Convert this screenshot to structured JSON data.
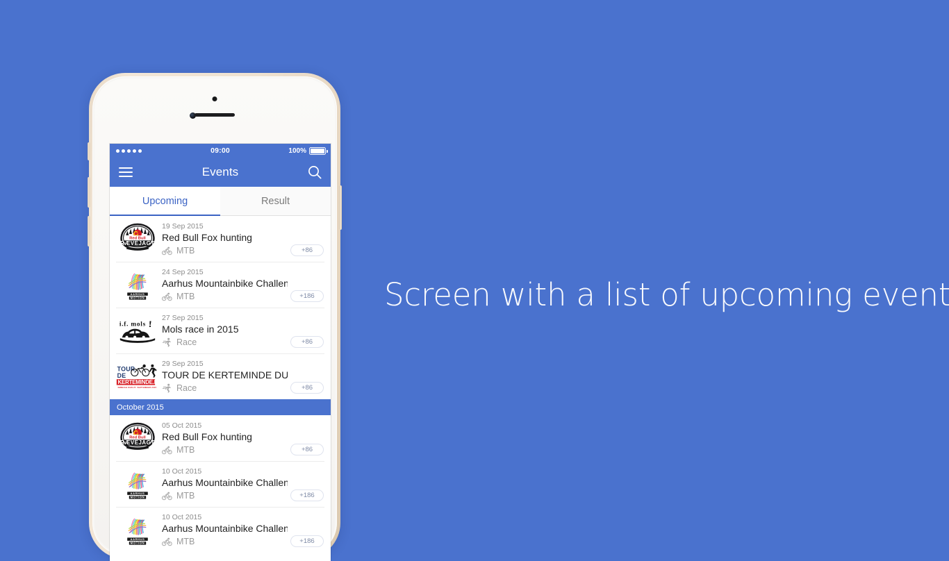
{
  "caption": "Screen with a list of upcoming events",
  "theme": {
    "background": "#4a72ce",
    "navbar": "#4a72ce",
    "accent": "#3b63c4",
    "month_header_bg": "#4a72ce"
  },
  "phone": {
    "status_bar": {
      "signal_dots": 5,
      "time": "09:00",
      "battery_percent": "100%",
      "battery_icon": "battery-full-icon"
    },
    "nav_bar": {
      "menu_icon": "hamburger-menu-icon",
      "title": "Events",
      "search_icon": "search-icon"
    },
    "tabs": [
      {
        "label": "Upcoming",
        "active": true
      },
      {
        "label": "Result",
        "active": false
      }
    ],
    "sections": [
      {
        "header": null,
        "events": [
          {
            "date": "19 Sep 2015",
            "title": "Red Bull Fox hunting",
            "sport": "MTB",
            "sport_icon": "bicycle-icon",
            "badge": "+86",
            "logo": "red-bull-raevejagt-logo"
          },
          {
            "date": "24 Sep 2015",
            "title": "Aarhus Mountainbike Challenge",
            "sport": "MTB",
            "sport_icon": "bicycle-icon",
            "badge": "+186",
            "logo": "aarhus-motion-logo"
          },
          {
            "date": "27 Sep 2015",
            "title": "Mols race in 2015",
            "sport": "Race",
            "sport_icon": "runner-icon",
            "badge": "+86",
            "logo": "if-mols-logo"
          },
          {
            "date": "29 Sep 2015",
            "title": "TOUR DE KERTEMINDE DURING...",
            "sport": "Race",
            "sport_icon": "runner-icon",
            "badge": "+86",
            "logo": "tour-de-kerteminde-logo"
          }
        ]
      },
      {
        "header": "October 2015",
        "events": [
          {
            "date": "05 Oct 2015",
            "title": "Red Bull Fox hunting",
            "sport": "MTB",
            "sport_icon": "bicycle-icon",
            "badge": "+86",
            "logo": "red-bull-raevejagt-logo"
          },
          {
            "date": "10 Oct 2015",
            "title": "Aarhus Mountainbike Challenge",
            "sport": "MTB",
            "sport_icon": "bicycle-icon",
            "badge": "+186",
            "logo": "aarhus-motion-logo"
          },
          {
            "date": "10 Oct 2015",
            "title": "Aarhus Mountainbike Challenge",
            "sport": "MTB",
            "sport_icon": "bicycle-icon",
            "badge": "+186",
            "logo": "aarhus-motion-logo"
          }
        ]
      }
    ]
  }
}
